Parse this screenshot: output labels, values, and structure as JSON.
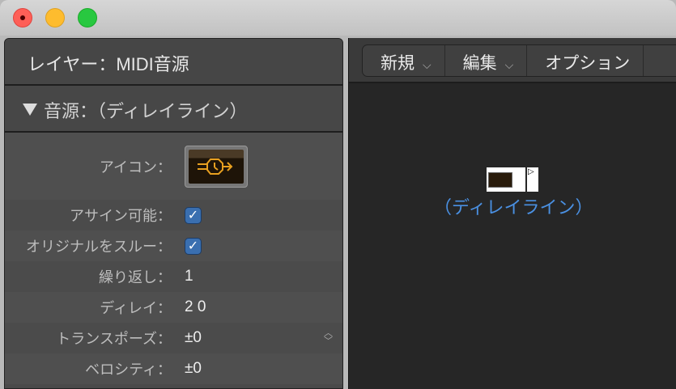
{
  "window": {
    "controls": [
      "close",
      "minimize",
      "zoom"
    ]
  },
  "inspector": {
    "header": "レイヤー：MIDI音源",
    "section": "音源：（ディレイライン）",
    "rows": {
      "icon": {
        "label": "アイコン："
      },
      "assignable": {
        "label": "アサイン可能：",
        "checked": true
      },
      "thru": {
        "label": "オリジナルをスルー：",
        "checked": true
      },
      "repeat": {
        "label": "繰り返し：",
        "value": "1"
      },
      "delay": {
        "label": "ディレイ：",
        "value": "2 0"
      },
      "transpose": {
        "label": "トランスポーズ：",
        "value": "±0"
      },
      "velocity": {
        "label": "ベロシティ：",
        "value": "±0"
      }
    },
    "check_glyph": "✓"
  },
  "toolbar": {
    "new": "新規",
    "edit": "編集",
    "options": "オプション",
    "chevron": "⌵"
  },
  "canvas": {
    "object_label": "（ディレイライン）"
  },
  "colors": {
    "accent": "#4a90e2",
    "checkbox": "#3a6fb0",
    "icon": "#e8a020"
  }
}
